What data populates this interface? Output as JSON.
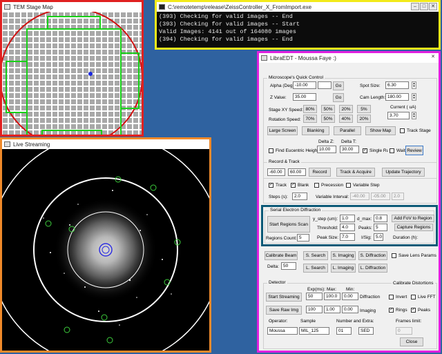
{
  "stage_map": {
    "title": "TEM Stage Map"
  },
  "console": {
    "title": "C:\\remotetemp\\release\\ZeissController_X_FromImport.exe",
    "lines": [
      "(393) Checking for valid images -- End",
      "(393) Checking for valid images -- Start",
      "Valid Images: 4141 out of 164080 images",
      "(394) Checking for valid images -- End"
    ]
  },
  "live": {
    "title": "Live Streaming"
  },
  "libra": {
    "title": "LibraEDT - Moussa Faye :)",
    "quick": {
      "title": "Microscope's Quick Control",
      "alpha_label": "Alpha (Deg):",
      "alpha_value": "-10.00",
      "z_label": "Z Value:",
      "z_value": "35.00",
      "go": "Go",
      "spot_label": "Spot Size:",
      "spot_value": "6.30",
      "cam_label": "Cam Length:",
      "cam_value": "180.00",
      "stage_speed_label": "Stage XY Speed:",
      "stage_speeds": [
        "80%",
        "50%",
        "20%",
        "5%"
      ],
      "rot_speed_label": "Rotation Speed:",
      "rot_speeds": [
        "70%",
        "50%",
        "40%",
        "20%"
      ],
      "current_label": "Current ( uA)",
      "current_value": "3.70",
      "large_screen": "Large Screen",
      "blanking": "Blanking",
      "parallel": "Parallel",
      "show_map": "Show Map",
      "track_stage": "Track Stage",
      "find_eucentric": "Find Eucentric Height",
      "delta_z_label": "Delta Z:",
      "delta_z_value": "10.00",
      "delta_t_label": "Delta T:",
      "delta_t_value": "30.00",
      "single_run": "Single Run",
      "wait": "Wait",
      "review": "Review"
    },
    "record": {
      "title": "Record & Track",
      "v1": "-60.00",
      "v2": "60.00",
      "record": "Record",
      "track_acquire": "Track & Acquire",
      "update_traj": "Update Trajectory",
      "track": "Track",
      "blank": "Blank",
      "precession": "Precession",
      "variable_step": "Variable Step",
      "steps_label": "Steps (s):",
      "steps_value": "2.0",
      "var_interval_label": "Variable Interval:",
      "vi1": "-40.00",
      "vi2": "-05.00",
      "vi3": "2.0"
    },
    "serial": {
      "title": "Serial Electron Diffraction",
      "start_scan": "Start Regions Scan",
      "regions_count_label": "Regions Count:",
      "regions_count_value": "5",
      "ystep_label": "y_step (um):",
      "ystep_value": "1.0",
      "threshold_label": "Threshold:",
      "threshold_value": "4.0",
      "peaksize_label": "Peak Size:",
      "peaksize_value": "7.0",
      "dmax_label": "d_max:",
      "dmax_value": "0.8",
      "peaks_label": "Peaks:",
      "peaks_value": "5",
      "isig_label": "I/Sig:",
      "isig_value": "5.0",
      "add_fov": "Add FoV to Region",
      "capture": "Capture Regions",
      "duration_label": "Duration (h):"
    },
    "calib": {
      "calibrate_beam": "Calibrate Beam",
      "delta_label": "Delta:",
      "delta_value": "50",
      "s_search": "S. Search",
      "s_imaging": "S. Imaging",
      "s_diffraction": "S. Diffraction",
      "l_search": "L. Search",
      "l_imaging": "L. Imaging",
      "l_diffraction": "L. Diffraction",
      "save_lens": "Save Lens Params"
    },
    "detector": {
      "title": "Detector",
      "calibrate_distortions": "Calibrate Distortions",
      "start_streaming": "Start Streaming",
      "save_raw": "Save Raw Img",
      "exp_label": "Exp(ms):",
      "max_label": "Max:",
      "min_label": "Min:",
      "exp_value": "50",
      "max_value": "100.0",
      "min_value": "0.00",
      "diffraction": "Diffraction",
      "invert": "Invert",
      "live_fft": "Live FFT",
      "v2a": "100",
      "v2b": "1.00",
      "v2c": "0.00",
      "imaging": "Imaging",
      "rings": "Rings",
      "peaks": "Peaks",
      "operator_label": "Operator:",
      "sample_label": "Sample",
      "number_label": "Number and Extra:",
      "operator_value": "Moussa",
      "sample_value": "MIL_125",
      "number_value": "01",
      "extra_value": "SED",
      "frames_label": "Frames limit:",
      "frames_value": "0",
      "close": "Close"
    }
  },
  "colors": {
    "desktop": "#2f62a0",
    "stage_border": "#e02020",
    "console_border": "#f2ea1a",
    "live_border": "#f08a2a",
    "libra_border": "#e020e0",
    "serial_border": "#0d5a78"
  }
}
